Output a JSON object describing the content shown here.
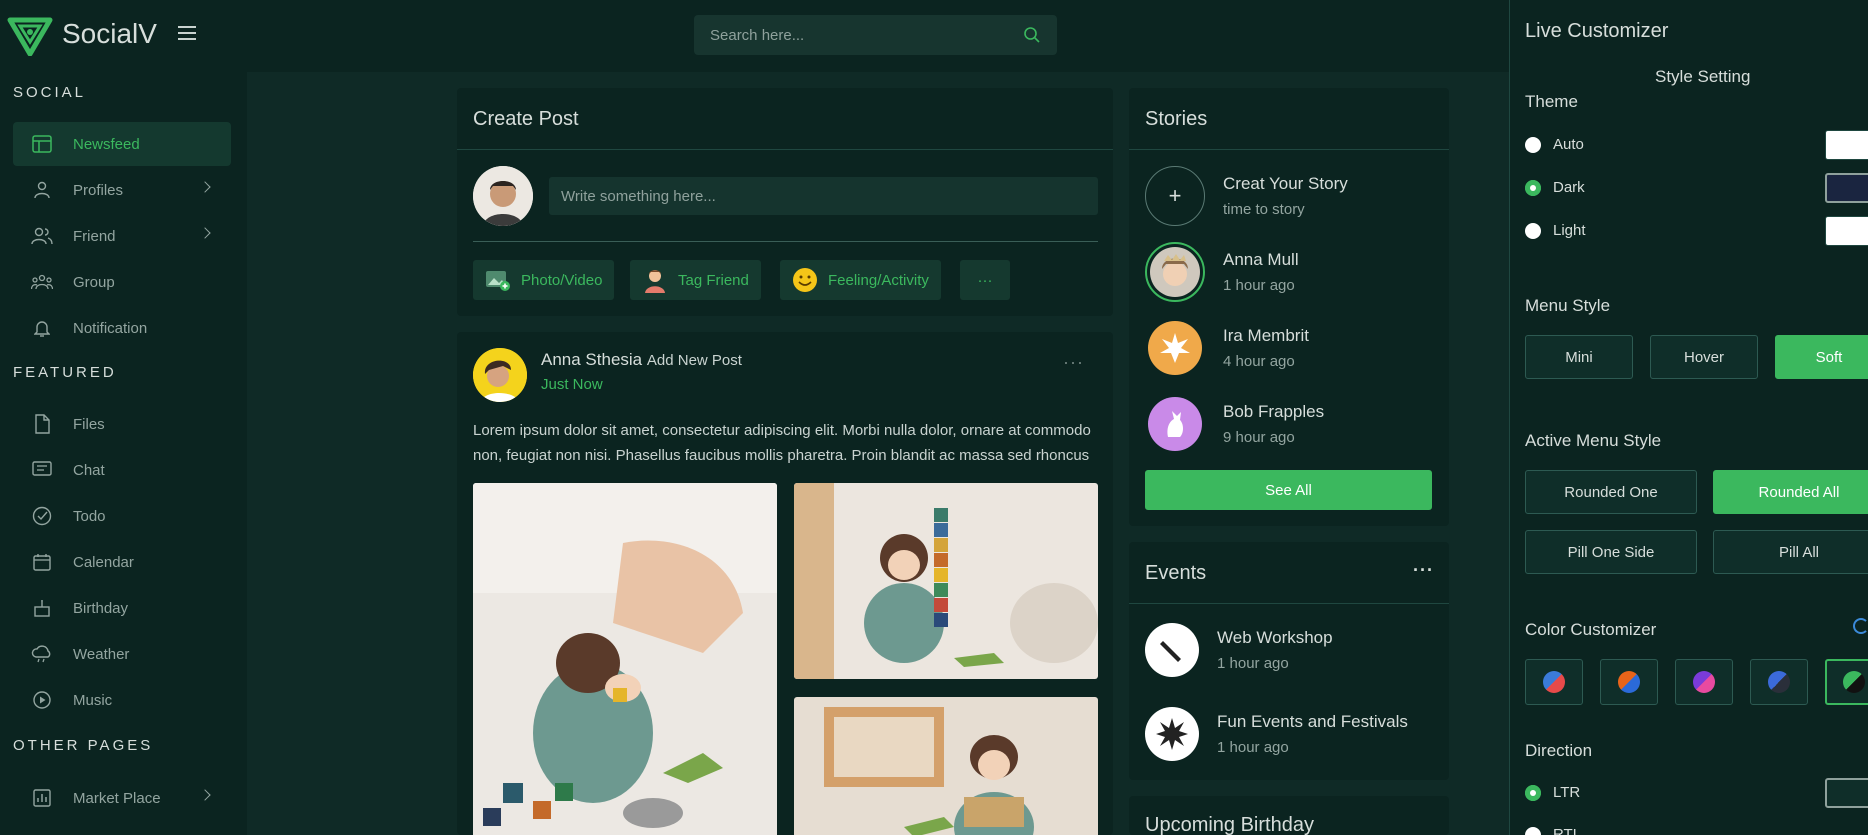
{
  "app": {
    "name": "SocialV"
  },
  "search": {
    "placeholder": "Search here..."
  },
  "sidebar": {
    "sections": [
      {
        "title": "SOCIAL"
      },
      {
        "title": "FEATURED"
      },
      {
        "title": "OTHER PAGES"
      }
    ],
    "items": [
      {
        "label": "Newsfeed",
        "icon": "newsfeed-icon",
        "active": true
      },
      {
        "label": "Profiles",
        "icon": "profile-icon"
      },
      {
        "label": "Friend",
        "icon": "friends-icon"
      },
      {
        "label": "Group",
        "icon": "group-icon"
      },
      {
        "label": "Notification",
        "icon": "bell-icon"
      },
      {
        "label": "Files",
        "icon": "file-icon"
      },
      {
        "label": "Chat",
        "icon": "chat-icon"
      },
      {
        "label": "Todo",
        "icon": "check-circle-icon"
      },
      {
        "label": "Calendar",
        "icon": "calendar-icon"
      },
      {
        "label": "Birthday",
        "icon": "cake-icon"
      },
      {
        "label": "Weather",
        "icon": "cloud-icon"
      },
      {
        "label": "Music",
        "icon": "play-icon"
      },
      {
        "label": "Market Place",
        "icon": "chart-icon"
      }
    ]
  },
  "create_post": {
    "title": "Create Post",
    "input_placeholder": "Write something here...",
    "actions": [
      {
        "label": "Photo/Video",
        "icon": "photo-icon"
      },
      {
        "label": "Tag Friend",
        "icon": "tag-friend-icon"
      },
      {
        "label": "Feeling/Activity",
        "icon": "smiley-icon"
      }
    ],
    "more_label": "···"
  },
  "post": {
    "author": "Anna Sthesia",
    "action": "Add New Post",
    "time": "Just Now",
    "menu_label": "···",
    "text": "Lorem ipsum dolor sit amet, consectetur adipiscing elit. Morbi nulla dolor, ornare at commodo non, feugiat non nisi. Phasellus faucibus mollis pharetra. Proin blandit ac massa sed rhoncus"
  },
  "stories": {
    "title": "Stories",
    "items": [
      {
        "name": "Creat Your Story",
        "sub": "time to story",
        "plus": "+"
      },
      {
        "name": "Anna Mull",
        "sub": "1 hour ago"
      },
      {
        "name": "Ira Membrit",
        "sub": "4 hour ago"
      },
      {
        "name": "Bob Frapples",
        "sub": "9 hour ago"
      }
    ],
    "see_all": "See All"
  },
  "events": {
    "title": "Events",
    "menu_label": "···",
    "items": [
      {
        "name": "Web Workshop",
        "sub": "1 hour ago"
      },
      {
        "name": "Fun Events and Festivals",
        "sub": "1 hour ago"
      }
    ]
  },
  "birthday": {
    "title": "Upcoming Birthday"
  },
  "customizer": {
    "title": "Live Customizer",
    "subtitle": "Style Setting",
    "theme": {
      "heading": "Theme",
      "options": [
        "Auto",
        "Dark",
        "Light"
      ],
      "selected": "Dark"
    },
    "menu_style": {
      "heading": "Menu Style",
      "options": [
        "Mini",
        "Hover",
        "Soft"
      ],
      "selected": "Soft"
    },
    "active_menu_style": {
      "heading": "Active Menu Style",
      "options": [
        "Rounded One",
        "Rounded All",
        "Pill One Side",
        "Pill All"
      ],
      "selected": "Rounded All"
    },
    "color_customizer": {
      "heading": "Color Customizer"
    },
    "direction": {
      "heading": "Direction",
      "options": [
        "LTR",
        "RTL"
      ],
      "selected": "LTR"
    }
  },
  "colors": {
    "accent": "#3bb85e",
    "background": "#0f2a26",
    "panel": "#0b2420"
  }
}
